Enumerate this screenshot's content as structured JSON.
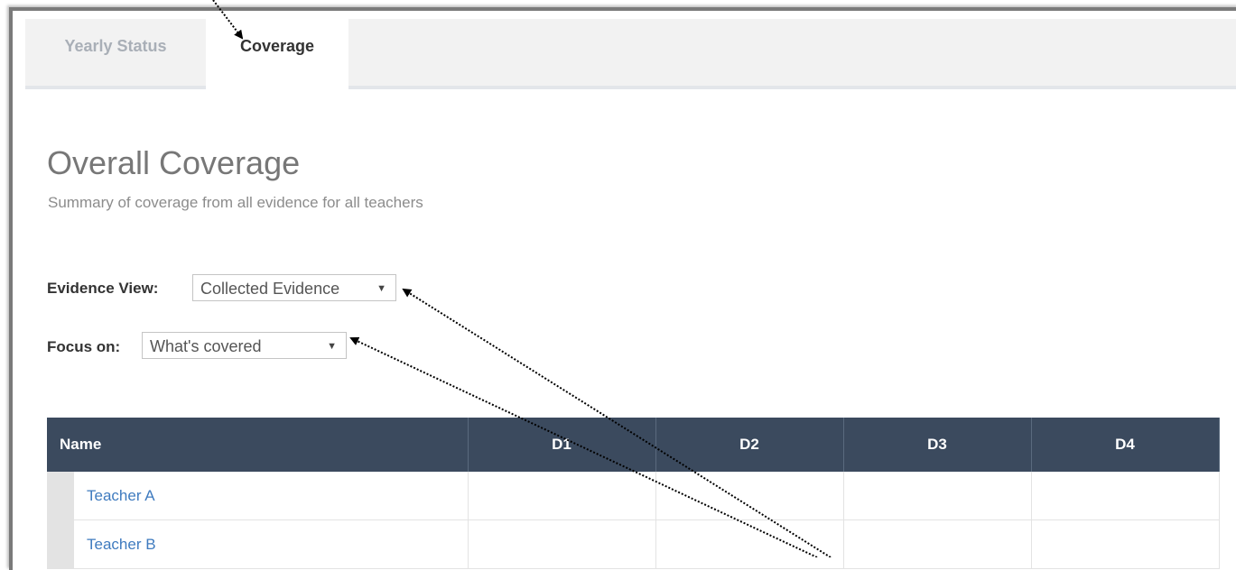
{
  "tabs": [
    {
      "label": "Yearly Status",
      "active": false
    },
    {
      "label": "Coverage",
      "active": true
    }
  ],
  "page": {
    "title": "Overall Coverage",
    "subtitle": "Summary of coverage from all evidence for all teachers"
  },
  "filters": {
    "evidence_view": {
      "label": "Evidence View:",
      "value": "Collected Evidence"
    },
    "focus_on": {
      "label": "Focus on:",
      "value": "What's covered"
    }
  },
  "table": {
    "columns": [
      "Name",
      "D1",
      "D2",
      "D3",
      "D4"
    ],
    "rows": [
      {
        "name": "Teacher A",
        "cells": [
          "",
          "",
          "",
          ""
        ]
      },
      {
        "name": "Teacher B",
        "cells": [
          "",
          "",
          "",
          ""
        ]
      }
    ]
  },
  "colors": {
    "header_bg": "#3b4a5e",
    "link": "#3f7bbf",
    "annotation_arrow": "#000000"
  }
}
